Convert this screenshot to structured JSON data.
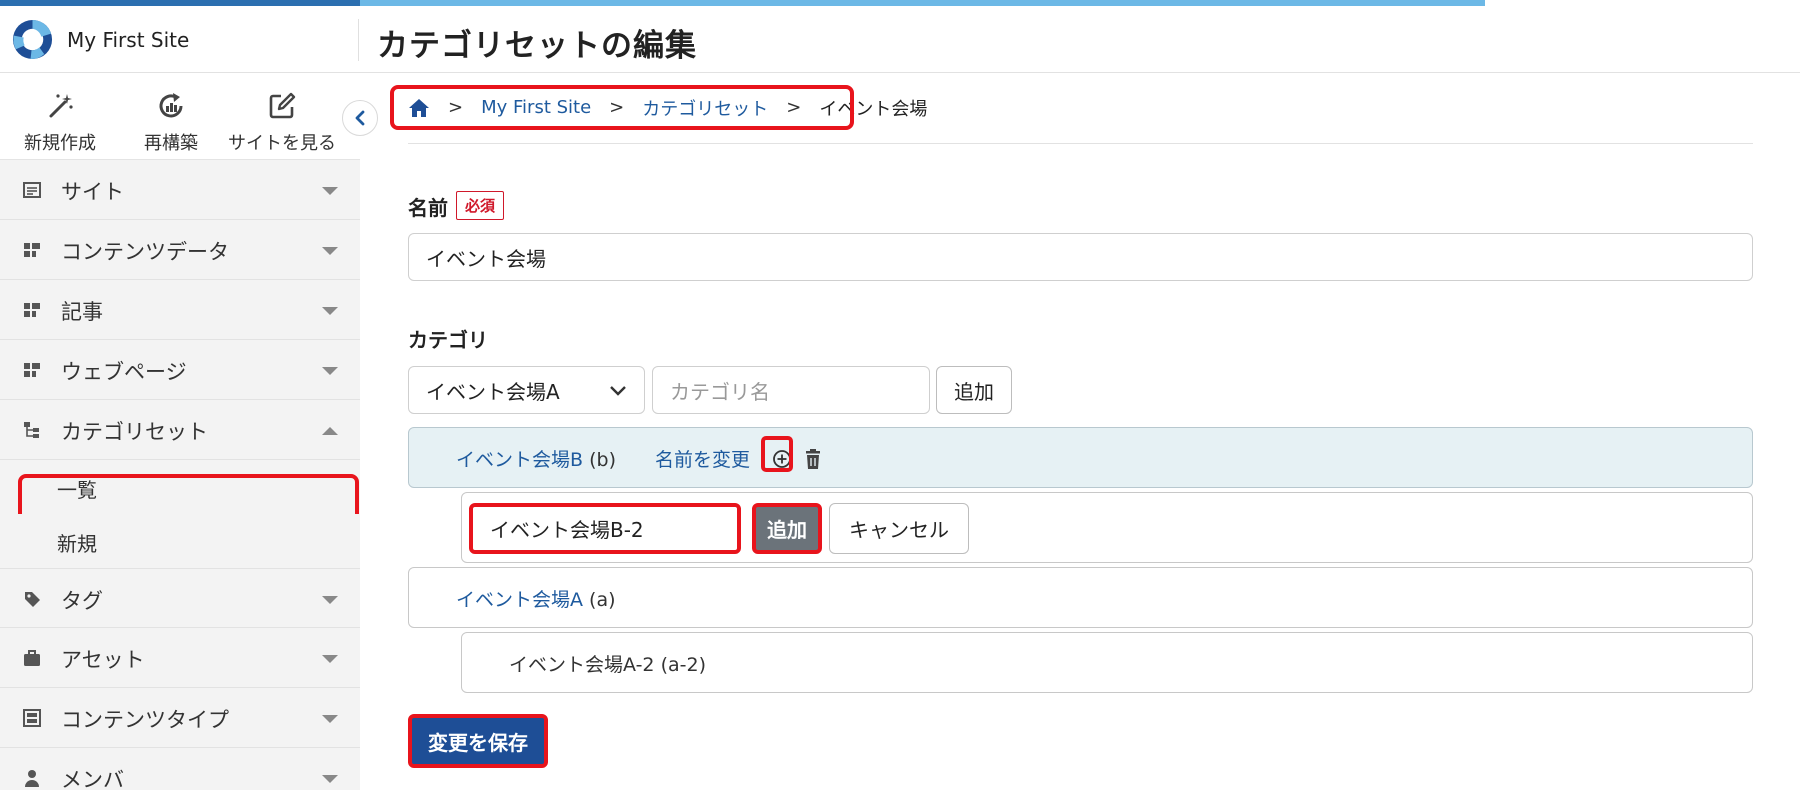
{
  "app": {
    "site_name": "My First Site",
    "page_title": "カテゴリセットの編集"
  },
  "quick_actions": [
    {
      "label": "新規作成",
      "icon": "magic-wand-icon"
    },
    {
      "label": "再構築",
      "icon": "rebuild-icon"
    },
    {
      "label": "サイトを見る",
      "icon": "view-site-icon"
    }
  ],
  "sidebar": {
    "items": [
      {
        "label": "サイト",
        "icon": "site-icon",
        "expanded": false
      },
      {
        "label": "コンテンツデータ",
        "icon": "content-data-icon",
        "expanded": false
      },
      {
        "label": "記事",
        "icon": "entry-icon",
        "expanded": false
      },
      {
        "label": "ウェブページ",
        "icon": "webpage-icon",
        "expanded": false
      },
      {
        "label": "カテゴリセット",
        "icon": "category-set-icon",
        "expanded": true
      },
      {
        "label": "タグ",
        "icon": "tag-icon",
        "expanded": false
      },
      {
        "label": "アセット",
        "icon": "asset-icon",
        "expanded": false
      },
      {
        "label": "コンテンツタイプ",
        "icon": "content-type-icon",
        "expanded": false
      },
      {
        "label": "メンバ",
        "icon": "member-icon",
        "expanded": false
      }
    ],
    "submenu": [
      {
        "label": "一覧"
      },
      {
        "label": "新規"
      }
    ]
  },
  "breadcrumb": {
    "items": [
      "My First Site",
      "カテゴリセット"
    ],
    "current": "イベント会場",
    "separator": ">"
  },
  "form": {
    "name_label": "名前",
    "required_label": "必須",
    "name_value": "イベント会場",
    "category_label": "カテゴリ",
    "parent_select_value": "イベント会場A",
    "category_name_placeholder": "カテゴリ名",
    "add_button": "追加"
  },
  "categories": {
    "b": {
      "label": "イベント会場B",
      "slug": "(b)",
      "rename_label": "名前を変更"
    },
    "b_new": {
      "value": "イベント会場B-2",
      "add_label": "追加",
      "cancel_label": "キャンセル"
    },
    "a": {
      "label": "イベント会場A",
      "slug": "(a)"
    },
    "a2": {
      "label": "イベント会場A-2",
      "slug": "(a-2)"
    }
  },
  "save_button": "変更を保存",
  "colors": {
    "accent": "#1e4e96",
    "link": "#1e5a9e",
    "highlight": "#e8141c",
    "required": "#d0182a"
  }
}
